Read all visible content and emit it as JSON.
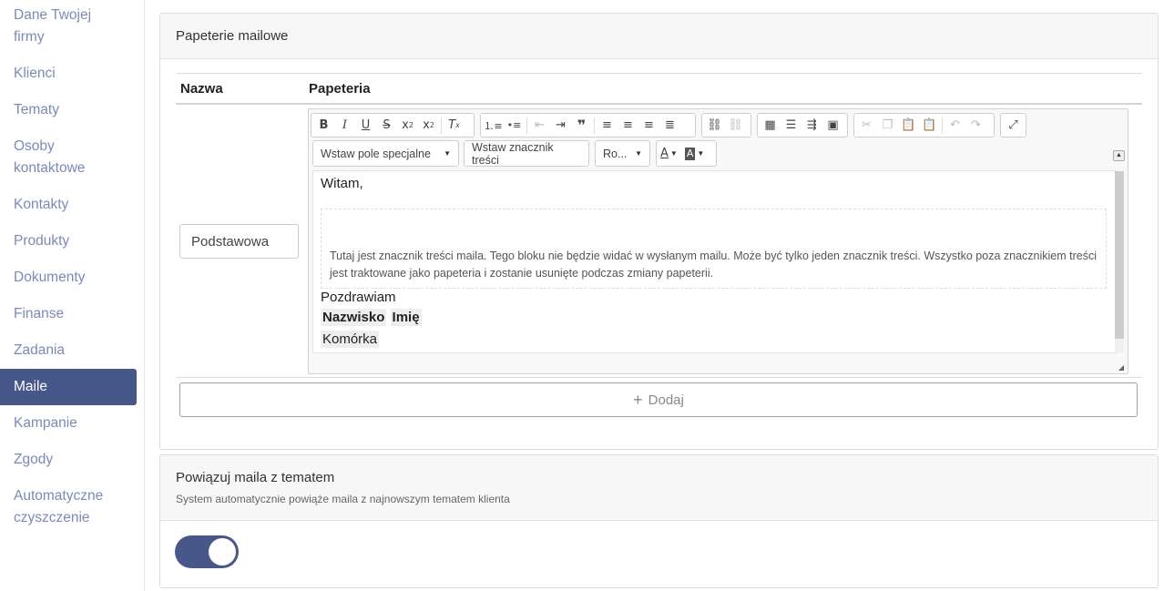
{
  "sidebar": {
    "items": [
      {
        "label": "Dane Twojej firmy"
      },
      {
        "label": "Klienci"
      },
      {
        "label": "Tematy"
      },
      {
        "label": "Osoby kontaktowe"
      },
      {
        "label": "Kontakty"
      },
      {
        "label": "Produkty"
      },
      {
        "label": "Dokumenty"
      },
      {
        "label": "Finanse"
      },
      {
        "label": "Zadania"
      },
      {
        "label": "Maile"
      },
      {
        "label": "Kampanie"
      },
      {
        "label": "Zgody"
      },
      {
        "label": "Automatyczne czyszczenie"
      }
    ],
    "active_index": 9,
    "active_color": "#47578a"
  },
  "stationery": {
    "title": "Papeterie mailowe",
    "col_name": "Nazwa",
    "col_stationery": "Papeteria",
    "row": {
      "name_value": "Podstawowa"
    },
    "editor": {
      "toolbar_icons": [
        "bold-icon",
        "italic-icon",
        "underline-icon",
        "strikethrough-icon",
        "subscript-icon",
        "superscript-icon",
        "remove-format-icon",
        "numbered-list-icon",
        "bulleted-list-icon",
        "outdent-icon",
        "indent-icon",
        "blockquote-icon",
        "align-left-icon",
        "align-center-icon",
        "align-right-icon",
        "justify-icon",
        "link-icon",
        "unlink-icon",
        "table-icon",
        "horizontal-rule-icon",
        "page-break-icon",
        "image-icon",
        "cut-icon",
        "copy-icon",
        "paste-icon",
        "paste-text-icon",
        "undo-icon",
        "redo-icon",
        "maximize-icon"
      ],
      "special_field_select": "Wstaw pole specjalne",
      "insert_marker_button": "Wstaw znacznik treści",
      "font_select": "Ro...",
      "greeting": "Witam,",
      "marker_text": "Tutaj jest znacznik treści maila. Tego bloku nie będzie widać w wysłanym mailu. Może być tylko jeden znacznik treści. Wszystko poza znacznikiem treści jest traktowane jako papeteria i zostanie usunięte podczas zmiany papeterii.",
      "closing": "Pozdrawiam",
      "field_surname": "Nazwisko",
      "field_firstname": "Imię",
      "field_mobile": "Komórka"
    },
    "add_button": "Dodaj",
    "add_icon": "plus-icon"
  },
  "link_mail": {
    "title": "Powiązuj maila z tematem",
    "subtitle": "System automatycznie powiąże maila z najnowszym tematem klienta",
    "toggle_on": true
  }
}
